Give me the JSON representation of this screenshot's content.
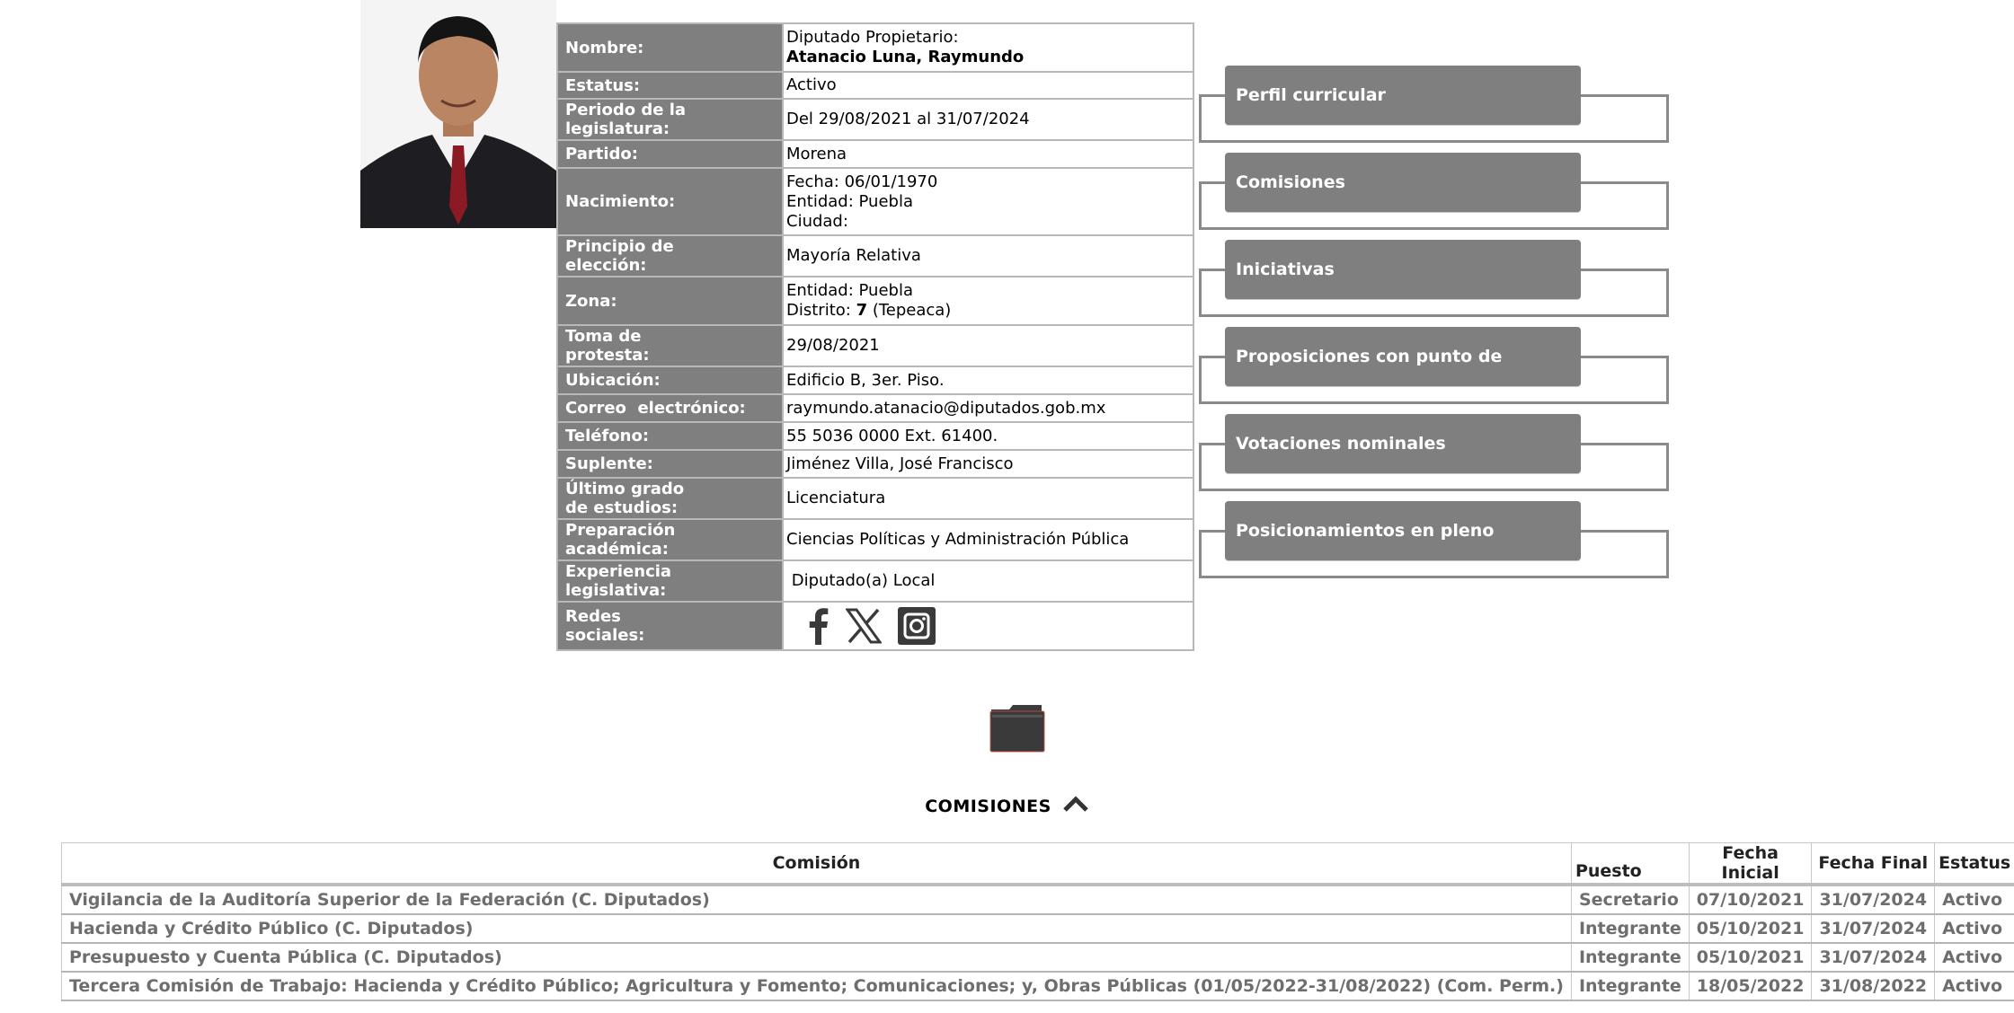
{
  "profile": {
    "rows": [
      {
        "label": "Nombre:",
        "lines": [
          "Diputado Propietario:"
        ],
        "bold_line": "Atanacio Luna, Raymundo"
      },
      {
        "label": "Estatus:",
        "value": "Activo"
      },
      {
        "label": "Periodo de la legislatura:",
        "value": "Del 29/08/2021 al 31/07/2024"
      },
      {
        "label": "Partido:",
        "value": "Morena"
      },
      {
        "label": "Nacimiento:",
        "lines": [
          "Fecha: 06/01/1970",
          "Entidad: Puebla",
          "Ciudad:"
        ]
      },
      {
        "label": "Principio de elección:",
        "value": "Mayoría Relativa"
      },
      {
        "label": "Zona:",
        "line1": "Entidad: Puebla",
        "distrito_prefix": "Distrito: ",
        "distrito_num": "7",
        "distrito_suffix": " (Tepeaca)"
      },
      {
        "label": "Toma de protesta:",
        "value": "29/08/2021"
      },
      {
        "label": "Ubicación:",
        "value": "Edificio B, 3er. Piso."
      },
      {
        "label": "Correo  electrónico:",
        "value": "raymundo.atanacio@diputados.gob.mx"
      },
      {
        "label": "Teléfono:",
        "value": "55 5036 0000 Ext. 61400."
      },
      {
        "label": "Suplente:",
        "value": "Jiménez Villa, José Francisco"
      },
      {
        "label": "Último grado de estudios:",
        "value": "Licenciatura"
      },
      {
        "label": "Preparación académica:",
        "value": "Ciencias Políticas y Administración Pública"
      },
      {
        "label": "Experiencia legislativa:",
        "value": " Diputado(a) Local"
      },
      {
        "label": "Redes sociales:"
      }
    ],
    "label_lines": {
      "periodo": [
        "Periodo de la",
        "legislatura:"
      ],
      "principio": [
        "Principio de",
        "elección:"
      ],
      "toma": [
        "Toma de",
        "protesta:"
      ],
      "grado": [
        "Último grado",
        "de estudios:"
      ],
      "preparacion": [
        "Preparación",
        "académica:"
      ],
      "experiencia": [
        "Experiencia",
        "legislativa:"
      ],
      "redes": [
        "Redes",
        "sociales:"
      ]
    },
    "social_icons": [
      "facebook-icon",
      "x-icon",
      "instagram-icon"
    ]
  },
  "menu": {
    "items": [
      "Perfil curricular",
      "Comisiones",
      "Iniciativas",
      "Proposiciones con punto de acuerdo",
      "Votaciones nominales",
      "Posicionamientos en pleno"
    ]
  },
  "section": {
    "title": "COMISIONES"
  },
  "commissions": {
    "headers": [
      "Comisión",
      "Puesto",
      "Fecha Inicial",
      "Fecha Final",
      "Estatus"
    ],
    "rows": [
      [
        "Vigilancia de la Auditoría Superior de la Federación (C. Diputados)",
        "Secretario",
        "07/10/2021",
        "31/07/2024",
        "Activo"
      ],
      [
        "Hacienda y Crédito Público (C. Diputados)",
        "Integrante",
        "05/10/2021",
        "31/07/2024",
        "Activo"
      ],
      [
        "Presupuesto y Cuenta Pública (C. Diputados)",
        "Integrante",
        "05/10/2021",
        "31/07/2024",
        "Activo"
      ],
      [
        "Tercera Comisión de Trabajo: Hacienda y Crédito Público; Agricultura y Fomento; Comunicaciones; y, Obras Públicas (01/05/2022-31/08/2022) (Com. Perm.)",
        "Integrante",
        "18/05/2022",
        "31/08/2022",
        "Activo"
      ]
    ]
  },
  "colors": {
    "label_bg": "#7f7f7f",
    "menu_bg": "#7f7f7f",
    "border": "#b8b8b8",
    "cell_text": "#6e6e6e"
  }
}
